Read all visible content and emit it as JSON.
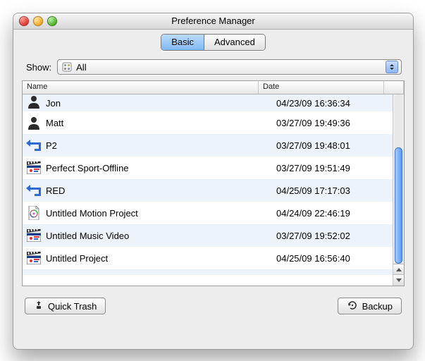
{
  "window": {
    "title": "Preference Manager"
  },
  "tabs": {
    "basic": "Basic",
    "advanced": "Advanced",
    "selected": "basic"
  },
  "show": {
    "label": "Show:",
    "value": "All"
  },
  "columns": {
    "name": "Name",
    "date": "Date"
  },
  "rows": [
    {
      "icon": "person",
      "name": "Jon",
      "date": "04/23/09 16:36:34",
      "partial": "top"
    },
    {
      "icon": "person",
      "name": "Matt",
      "date": "03/27/09 19:49:36"
    },
    {
      "icon": "arrow",
      "name": "P2",
      "date": "03/27/09 19:48:01"
    },
    {
      "icon": "clap",
      "name": "Perfect Sport-Offline",
      "date": "03/27/09 19:51:49"
    },
    {
      "icon": "arrow",
      "name": "RED",
      "date": "04/25/09 17:17:03"
    },
    {
      "icon": "doc",
      "name": "Untitled Motion Project",
      "date": "04/24/09 22:46:19"
    },
    {
      "icon": "clap",
      "name": "Untitled Music Video",
      "date": "03/27/09 19:52:02"
    },
    {
      "icon": "clap",
      "name": "Untitled Project",
      "date": "04/25/09 16:56:40"
    },
    {
      "icon": "blank",
      "name": "",
      "date": "",
      "partial": "bottom"
    }
  ],
  "buttons": {
    "quick_trash": "Quick Trash",
    "backup": "Backup"
  }
}
